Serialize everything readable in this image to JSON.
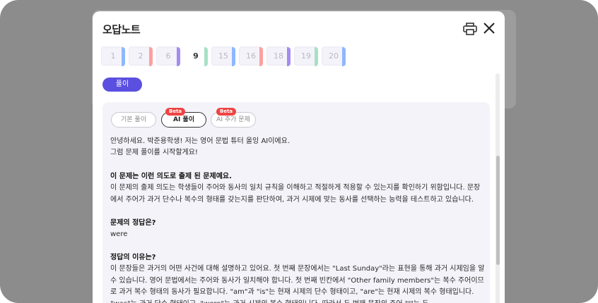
{
  "modal": {
    "title": "오답노트"
  },
  "question_nav": [
    {
      "label": "1",
      "color": "#8fb7ff",
      "current": false
    },
    {
      "label": "2",
      "color": "#ff9f9f",
      "current": false
    },
    {
      "label": "6",
      "color": "#a58cf0",
      "current": false
    },
    {
      "label": "9",
      "color": "#a8e0c4",
      "current": true
    },
    {
      "label": "15",
      "color": "#8fb7ff",
      "current": false
    },
    {
      "label": "16",
      "color": "#ff9f9f",
      "current": false
    },
    {
      "label": "18",
      "color": "#a58cf0",
      "current": false
    },
    {
      "label": "19",
      "color": "#a8e0c4",
      "current": false
    },
    {
      "label": "20",
      "color": "#8fb7ff",
      "current": false
    }
  ],
  "solve_button": "풀이",
  "tabs": {
    "basic": "기본 풀이",
    "ai": "AI 풀이",
    "ai_extra": "AI 추가 문제",
    "beta": "Beta"
  },
  "content": {
    "greeting_1": "안녕하세요. 박준용학생! 저는 영어 문법 튜터 올잉 AI이에요.",
    "greeting_2": "그럼 문제 풀이를 시작할게요!",
    "intent_heading": "이 문제는 이런 의도로 출제 된 문제예요.",
    "intent_body": "이 문제의 출제 의도는 학생들이 주어와 동사의 일치 규칙을 이해하고 적절하게 적용할 수 있는지를 확인하기 위함입니다. 문장에서 주어가 과거 단수나 복수의 형태를 갖는지를 판단하여, 과거 시제에 맞는 동사를 선택하는 능력을 테스트하고 있습니다.",
    "answer_heading": "문제의 정답은?",
    "answer_value": "were",
    "reason_heading": "정답의 이유는?",
    "reason_body": "이 문장들은 과거의 어떤 사건에 대해 설명하고 있어요. 첫 번째 문장에서는 \"Last Sunday\"라는 표현을 통해 과거 시제임을 알 수 있습니다. 영어 문법에서는 주어와 동사가 일치해야 합니다. 첫 번째 빈칸에서 \"Other family members\"는 복수 주어이므로 과거 복수 형태의 동사가 필요합니다. \"am\"과 \"is\"는 현재 시제의 단수 형태이고, \"are\"는 현재 시제의 복수 형태입니다. \"was\"는 과거 단수 형태이고, \"were\"는 과거 시제의 복수 형태입니다. 따라서 두 번째 문장의 주어 \"I\"는 두"
  }
}
